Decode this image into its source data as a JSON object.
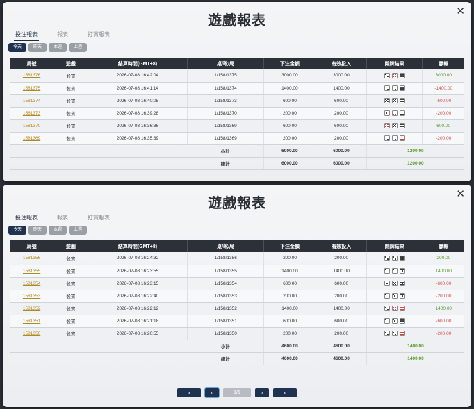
{
  "window_title": "遊戲報表",
  "close_symbol": "✕",
  "tabs": [
    "投注報表",
    "報表",
    "打賞報表"
  ],
  "quick_filters": [
    "今天",
    "昨天",
    "本週",
    "上週"
  ],
  "table_headers": [
    "局號",
    "遊戲",
    "結算時間(GMT+8)",
    "桌/靴/局",
    "下注金額",
    "有效投入",
    "開牌結果",
    "贏輸"
  ],
  "top": {
    "rows": [
      {
        "id": "1581376",
        "game": "骰寶",
        "time": "2026-07-08 16:42:04",
        "table": "1/158/1375",
        "bet": "3000.00",
        "valid": "3000.00",
        "dice": [
          2,
          4,
          6
        ],
        "red": [
          false,
          true,
          false
        ],
        "win": "3000.00",
        "positive": true
      },
      {
        "id": "1581375",
        "game": "骰寶",
        "time": "2026-07-08 16:41:14",
        "table": "1/158/1374",
        "bet": "1400.00",
        "valid": "1400.00",
        "dice": [
          2,
          2,
          6
        ],
        "red": [
          false,
          false,
          false
        ],
        "win": "-1400.00",
        "positive": false
      },
      {
        "id": "1581374",
        "game": "骰寶",
        "time": "2026-07-08 16:40:05",
        "table": "1/158/1373",
        "bet": "600.00",
        "valid": "600.00",
        "dice": [
          5,
          5,
          5
        ],
        "red": [
          false,
          false,
          false
        ],
        "win": "-600.00",
        "positive": false
      },
      {
        "id": "1581373",
        "game": "骰寶",
        "time": "2026-07-08 16:39:28",
        "table": "1/158/1370",
        "bet": "200.00",
        "valid": "200.00",
        "dice": [
          1,
          4,
          5
        ],
        "red": [
          false,
          true,
          false
        ],
        "win": "-200.00",
        "positive": false
      },
      {
        "id": "1581370",
        "game": "骰寶",
        "time": "2026-07-08 16:36:36",
        "table": "1/158/1369",
        "bet": "600.00",
        "valid": "600.00",
        "dice": [
          4,
          5,
          5
        ],
        "red": [
          true,
          false,
          false
        ],
        "win": "600.00",
        "positive": true
      },
      {
        "id": "1581369",
        "game": "骰寶",
        "time": "2026-07-08 16:35:39",
        "table": "1/158/1369",
        "bet": "200.00",
        "valid": "200.00",
        "dice": [
          2,
          2,
          4
        ],
        "red": [
          false,
          false,
          true
        ],
        "win": "-200.00",
        "positive": false
      }
    ],
    "subtotal": {
      "label": "小計",
      "bet": "6000.00",
      "valid": "6000.00",
      "win": "1200.00"
    },
    "total": {
      "label": "總計",
      "bet": "6000.00",
      "valid": "6000.00",
      "win": "1200.00"
    }
  },
  "bottom": {
    "rows": [
      {
        "id": "1581356",
        "game": "骰寶",
        "time": "2026-07-08 16:24:32",
        "table": "1/158/1356",
        "bet": "200.00",
        "valid": "200.00",
        "dice": [
          2,
          2,
          5
        ],
        "red": [
          false,
          false,
          false
        ],
        "win": "200.00",
        "positive": true
      },
      {
        "id": "1581355",
        "game": "骰寶",
        "time": "2026-07-08 16:23:55",
        "table": "1/158/1355",
        "bet": "1400.00",
        "valid": "1400.00",
        "dice": [
          2,
          2,
          5
        ],
        "red": [
          false,
          false,
          false
        ],
        "win": "1400.00",
        "positive": true
      },
      {
        "id": "1581354",
        "game": "骰寶",
        "time": "2026-07-08 16:23:15",
        "table": "1/158/1354",
        "bet": "600.00",
        "valid": "600.00",
        "dice": [
          1,
          5,
          5
        ],
        "red": [
          false,
          false,
          false
        ],
        "win": "-600.00",
        "positive": false
      },
      {
        "id": "1581353",
        "game": "骰寶",
        "time": "2026-07-08 16:22:40",
        "table": "1/158/1353",
        "bet": "200.00",
        "valid": "200.00",
        "dice": [
          2,
          3,
          5
        ],
        "red": [
          false,
          false,
          false
        ],
        "win": "-200.00",
        "positive": false
      },
      {
        "id": "1581352",
        "game": "骰寶",
        "time": "2026-07-08 16:22:12",
        "table": "1/158/1352",
        "bet": "1400.00",
        "valid": "1400.00",
        "dice": [
          2,
          4,
          4
        ],
        "red": [
          false,
          true,
          true
        ],
        "win": "1400.00",
        "positive": true
      },
      {
        "id": "1581351",
        "game": "骰寶",
        "time": "2026-07-08 16:21:18",
        "table": "1/158/1351",
        "bet": "600.00",
        "valid": "600.00",
        "dice": [
          2,
          3,
          6
        ],
        "red": [
          false,
          false,
          false
        ],
        "win": "-600.00",
        "positive": false
      },
      {
        "id": "1581350",
        "game": "骰寶",
        "time": "2026-07-08 16:20:55",
        "table": "1/158/1350",
        "bet": "200.00",
        "valid": "200.00",
        "dice": [
          2,
          2,
          4
        ],
        "red": [
          false,
          false,
          true
        ],
        "win": "-200.00",
        "positive": false
      }
    ],
    "subtotal": {
      "label": "小計",
      "bet": "4600.00",
      "valid": "4600.00",
      "win": "1400.00"
    },
    "total": {
      "label": "總計",
      "bet": "4600.00",
      "valid": "4600.00",
      "win": "1400.00"
    }
  },
  "pagination": {
    "first": "«",
    "prev": "‹",
    "info": "1/1",
    "next": "›",
    "last": "»"
  }
}
